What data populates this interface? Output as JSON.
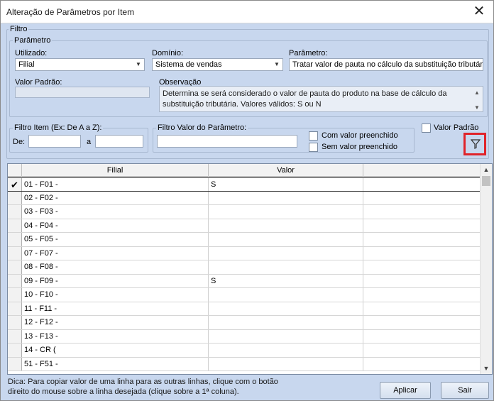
{
  "window": {
    "title": "Alteração de Parâmetros por Item",
    "close_glyph": "✕"
  },
  "filtro": {
    "legend": "Filtro",
    "parametro_group": {
      "legend": "Parâmetro",
      "utilizado_label": "Utilizado:",
      "utilizado_value": "Filial",
      "dominio_label": "Domínio:",
      "dominio_value": "Sistema de vendas",
      "parametro_label": "Parâmetro:",
      "parametro_value": "Tratar valor de pauta no cálculo da substituição tributária",
      "valor_padrao_label": "Valor Padrão:",
      "valor_padrao_value": "",
      "observacao_label": "Observação",
      "observacao_text": "Determina se será considerado o valor de pauta do produto na base de cálculo da substituição tributária. Valores válidos: S ou N"
    },
    "filtro_item": {
      "legend": "Filtro Item (Ex: De A a Z):",
      "de_label": "De:",
      "a_label": "a",
      "de_value": "",
      "a_value": ""
    },
    "filtro_valor": {
      "legend": "Filtro Valor do Parâmetro:",
      "value": "",
      "com_valor_label": "Com valor preenchido",
      "sem_valor_label": "Sem valor preenchido"
    },
    "valor_padrao_check_label": "Valor Padrão",
    "filter_icon": "filter-funnel-icon"
  },
  "grid": {
    "columns": [
      "Filial",
      "Valor"
    ],
    "rows": [
      {
        "filial": "01 - F01 -",
        "valor": "S",
        "selected": true
      },
      {
        "filial": "02 - F02 -",
        "valor": ""
      },
      {
        "filial": "03 - F03 -",
        "valor": ""
      },
      {
        "filial": "04 - F04 -",
        "valor": ""
      },
      {
        "filial": "05 - F05 -",
        "valor": ""
      },
      {
        "filial": "07 - F07 -",
        "valor": ""
      },
      {
        "filial": "08 - F08 -",
        "valor": ""
      },
      {
        "filial": "09 - F09 -",
        "valor": "S"
      },
      {
        "filial": "10 - F10 -",
        "valor": ""
      },
      {
        "filial": "11 - F11 -",
        "valor": ""
      },
      {
        "filial": "12 - F12 -",
        "valor": ""
      },
      {
        "filial": "13 - F13 -",
        "valor": ""
      },
      {
        "filial": "14 - CR (",
        "valor": ""
      },
      {
        "filial": "51 - F51 -",
        "valor": ""
      }
    ],
    "selected_indicator": "✔"
  },
  "footer": {
    "hint_line1": "Dica: Para copiar valor de uma linha para as outras linhas, clique com o botão",
    "hint_line2": "direito do mouse sobre a linha desejada (clique sobre a 1ª coluna).",
    "aplicar_label": "Aplicar",
    "sair_label": "Sair"
  },
  "colors": {
    "background": "#c8d7ee",
    "highlight": "#e0232a"
  }
}
